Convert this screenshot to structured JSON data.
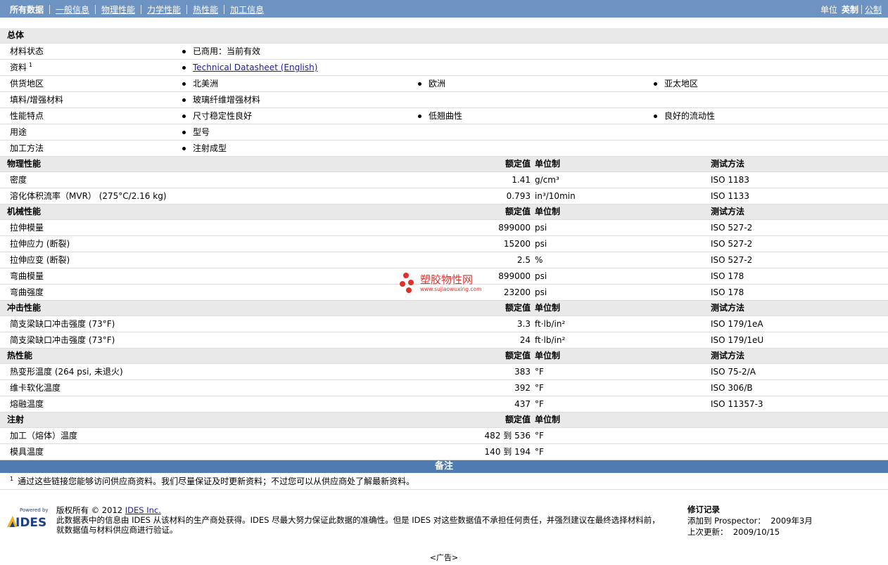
{
  "topbar": {
    "tabs": [
      "所有数据",
      "一般信息",
      "物理性能",
      "力学性能",
      "热性能",
      "加工信息"
    ],
    "units_label": "单位",
    "units_selected": "英制",
    "units_other": "公制"
  },
  "general": {
    "title": "总体",
    "rows": [
      {
        "label": "材料状态",
        "values": [
          "已商用：当前有效"
        ]
      },
      {
        "label": "资料",
        "sup": "1",
        "link": "Technical Datasheet (English)"
      },
      {
        "label": "供货地区",
        "values": [
          "北美洲",
          "欧洲",
          "亚太地区"
        ]
      },
      {
        "label": "填料/增强材料",
        "values": [
          "玻璃纤维增强材料"
        ]
      },
      {
        "label": "性能特点",
        "values": [
          "尺寸稳定性良好",
          "低翘曲性",
          "良好的流动性"
        ]
      },
      {
        "label": "用途",
        "values": [
          "型号"
        ]
      },
      {
        "label": "加工方法",
        "values": [
          "注射成型"
        ]
      }
    ]
  },
  "col_headers": {
    "nominal": "额定值",
    "unit": "单位制",
    "test": "测试方法"
  },
  "sections": [
    {
      "title": "物理性能",
      "rows": [
        {
          "label": "密度",
          "value": "1.41",
          "unit": "g/cm³",
          "test": "ISO 1183"
        },
        {
          "label": "溶化体积流率（MVR） (275°C/2.16 kg)",
          "value": "0.793",
          "unit": "in³/10min",
          "test": "ISO 1133"
        }
      ]
    },
    {
      "title": "机械性能",
      "rows": [
        {
          "label": "拉伸模量",
          "value": "899000",
          "unit": "psi",
          "test": "ISO 527-2"
        },
        {
          "label": "拉伸应力 (断裂)",
          "value": "15200",
          "unit": "psi",
          "test": "ISO 527-2"
        },
        {
          "label": "拉伸应变 (断裂)",
          "value": "2.5",
          "unit": "%",
          "test": "ISO 527-2"
        },
        {
          "label": "弯曲模量",
          "value": "899000",
          "unit": "psi",
          "test": "ISO 178"
        },
        {
          "label": "弯曲强度",
          "value": "23200",
          "unit": "psi",
          "test": "ISO 178"
        }
      ]
    },
    {
      "title": "冲击性能",
      "rows": [
        {
          "label": "简支梁缺口冲击强度 (73°F)",
          "value": "3.3",
          "unit": "ft·lb/in²",
          "test": "ISO 179/1eA"
        },
        {
          "label": "简支梁缺口冲击强度 (73°F)",
          "value": "24",
          "unit": "ft·lb/in²",
          "test": "ISO 179/1eU"
        }
      ]
    },
    {
      "title": "热性能",
      "rows": [
        {
          "label": "热变形温度 (264 psi, 未退火)",
          "value": "383",
          "unit": "°F",
          "test": "ISO 75-2/A"
        },
        {
          "label": "维卡软化温度",
          "value": "392",
          "unit": "°F",
          "test": "ISO 306/B"
        },
        {
          "label": "熔融温度",
          "value": "437",
          "unit": "°F",
          "test": "ISO 11357-3"
        }
      ]
    },
    {
      "title": "注射",
      "rows": [
        {
          "label": "加工（熔体）温度",
          "value": "482 到  536",
          "unit": "°F",
          "test": ""
        },
        {
          "label": "模具温度",
          "value": "140 到  194",
          "unit": "°F",
          "test": ""
        }
      ]
    }
  ],
  "notes": {
    "title": "备注",
    "sup": "1",
    "text": "通过这些链接您能够访问供应商资料。我们尽量保证及时更新资料；不过您可以从供应商处了解最新资料。"
  },
  "footer": {
    "logo_small": "Powered by",
    "logo_text": "IDES",
    "copyright_prefix": "版权所有  © 2012 ",
    "copyright_link": "IDES Inc.",
    "disclaimer_1": "此数据表中的信息由  IDES 从该材料的生产商处获得。IDES 尽最大努力保证此数据的准确性。但是  IDES 对这些数据值不承担任何责任，并强烈建议在最终选择材料前，",
    "disclaimer_2": "就数据值与材料供应商进行验证。",
    "revision_title": "修订记录",
    "added_label": "添加到  Prospector：",
    "added_value": "2009年3月",
    "updated_label": "上次更新：",
    "updated_value": "2009/10/15"
  },
  "ad": "<广告>",
  "watermark": {
    "cn": "塑胶物性网",
    "url": "www.sujiaowuxing.com",
    "color": "#e0302c"
  }
}
